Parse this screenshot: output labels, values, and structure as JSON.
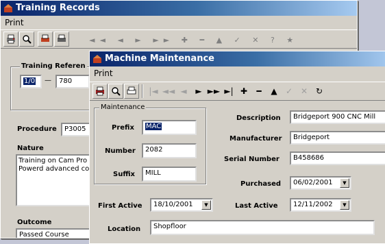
{
  "back_window": {
    "title": "Training Records",
    "menu": [
      "Print"
    ],
    "training_group_label": "Training Referen",
    "range_from": "1/0",
    "range_dash": "—",
    "range_to": "780",
    "procedure_label": "Procedure",
    "procedure_value": "P3005",
    "nature_label": "Nature",
    "nature_text_line1": "Training on Cam Pro",
    "nature_text_line2": "Powerd advanced co",
    "outcome_label": "Outcome",
    "outcome_value": "Passed Course"
  },
  "front_window": {
    "title": "Machine Maintenance",
    "menu": [
      "Print"
    ],
    "group_label": "Maintenance",
    "prefix_label": "Prefix",
    "prefix_value": "MAC",
    "number_label": "Number",
    "number_value": "2082",
    "suffix_label": "Suffix",
    "suffix_value": "MILL",
    "description_label": "Description",
    "description_value": "Bridgeport 900 CNC Mill",
    "manufacturer_label": "Manufacturer",
    "manufacturer_value": "Bridgeport",
    "serial_label": "Serial Number",
    "serial_value": "B458686",
    "purchased_label": "Purchased",
    "purchased_value": "06/02/2001",
    "first_active_label": "First Active",
    "first_active_value": "18/10/2001",
    "last_active_label": "Last Active",
    "last_active_value": "12/11/2002",
    "location_label": "Location",
    "location_value": "Shopfloor"
  },
  "colors": {
    "titlebar_start": "#0a246a",
    "titlebar_end": "#a6caf0",
    "selection": "#0a246a",
    "window_face": "#d4d0c8"
  },
  "icons": {
    "toolbar": [
      "print-icon",
      "preview-icon",
      "print-setup-icon",
      "first-icon",
      "prev-page-icon",
      "prev-icon",
      "next-icon",
      "next-page-icon",
      "last-icon",
      "add-icon",
      "delete-icon",
      "save-icon",
      "undo-icon",
      "cancel-icon",
      "refresh-icon",
      "search-icon",
      "help-icon"
    ]
  }
}
